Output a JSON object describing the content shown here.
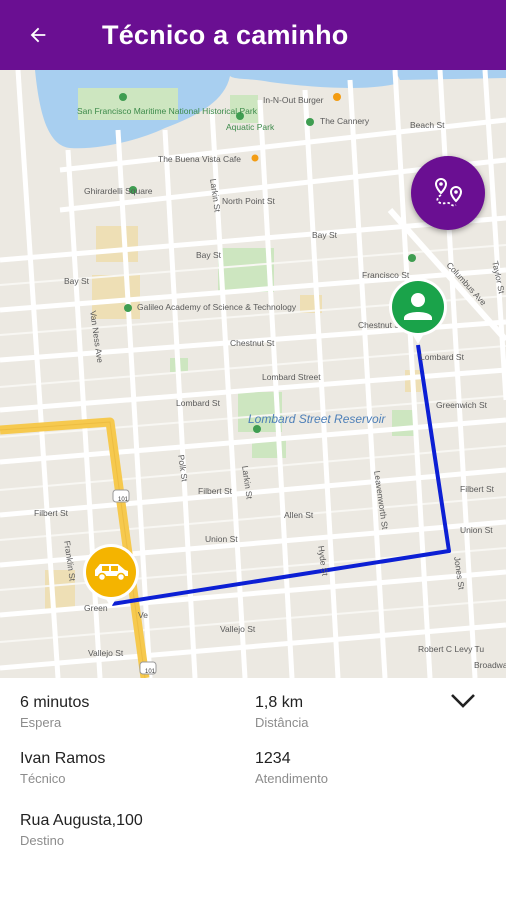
{
  "appbar": {
    "title": "Técnico a caminho",
    "back_icon": "arrow-left-icon",
    "color": "#6a0f92"
  },
  "map": {
    "labels": {
      "maritime_park": "San Francisco Maritime National Historical Park",
      "in_n_out": "In-N-Out Burger",
      "aquatic_park": "Aquatic Park",
      "cannery": "The Cannery",
      "beach_st": "Beach St",
      "buena_vista": "The Buena Vista Cafe",
      "ghirardelli": "Ghirardelli Square",
      "north_point": "North Point St",
      "larkin_st": "Larkin St",
      "bay_st_left": "Bay St",
      "bay_st_mid": "Bay St",
      "bay_st_right": "Bay St",
      "francisco_st": "Francisco St",
      "galileo": "Galileo Academy of Science & Technology",
      "columbus": "Columbus Ave",
      "taylor_st": "Taylor St",
      "chestnut_mid": "Chestnut St",
      "chestnut_right": "Chestnut St",
      "lombard_st_1": "Lombard St",
      "lombard_st_2": "Lombard Street",
      "lombard_st_3": "Lombard St",
      "greenwich_right": "Greenwich St",
      "lombard_reservoir": "Lombard Street Reservoir",
      "filbert_left": "Filbert St",
      "filbert_mid": "Filbert St",
      "filbert_right": "Filbert St",
      "allen_st": "Allen St",
      "union_st": "Union St",
      "union_right": "Union St",
      "green_st": "Green",
      "vallejo_left": "Vallejo St",
      "vallejo_mid": "Vallejo St",
      "robert_levy": "Robert C Levy Tu",
      "broadway": "Broadway",
      "van_ness": "Van Ness Ave",
      "franklin": "Franklin St",
      "hyde_st": "Hyde St",
      "leavenworth": "Leavenworth St",
      "jones_st": "Jones St",
      "polk_st": "Polk St",
      "hwy_101": "101",
      "hwy_101b": "101",
      "ve": "Ve"
    },
    "route_color": "#0c1fd4",
    "highway_color": "#f6c94e"
  },
  "fab": {
    "icon": "route-pins-icon",
    "color": "#6a0f92"
  },
  "markers": {
    "technician": {
      "icon": "person-icon",
      "color": "#1aa34a"
    },
    "vehicle": {
      "icon": "car-icon",
      "color": "#f4b400"
    }
  },
  "info": {
    "wait_value": "6 minutos",
    "wait_label": "Espera",
    "distance_value": "1,8 km",
    "distance_label": "Distância",
    "tech_value": "Ivan Ramos",
    "tech_label": "Técnico",
    "ticket_value": "1234",
    "ticket_label": "Atendimento",
    "dest_value": "Rua Augusta,100",
    "dest_label": "Destino",
    "collapse_icon": "chevron-down-icon"
  }
}
